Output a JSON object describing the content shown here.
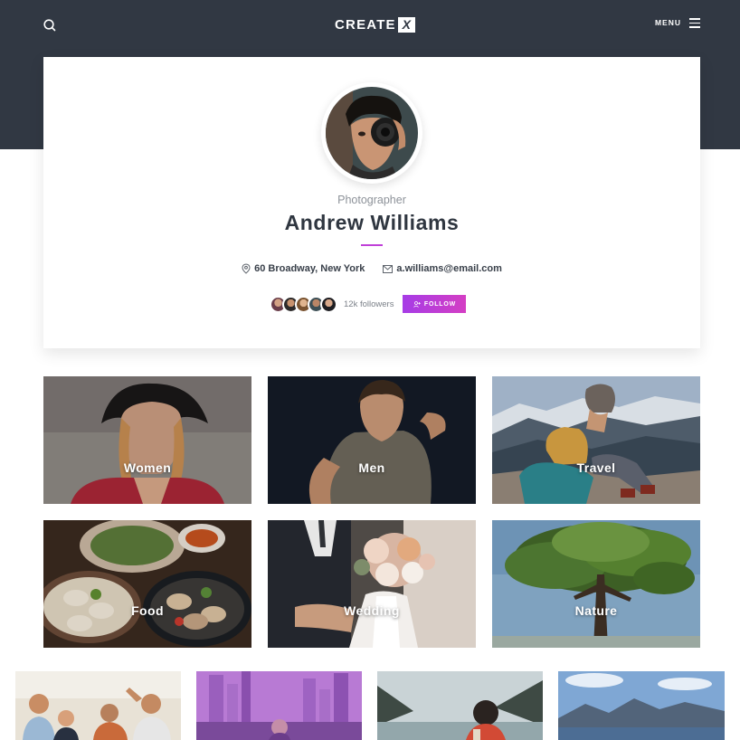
{
  "header": {
    "brand": "CREATE",
    "brand_badge": "X",
    "menu_label": "MENU",
    "icons": {
      "search": "search-icon",
      "menu": "hamburger-icon"
    },
    "background": "#313843"
  },
  "profile": {
    "role": "Photographer",
    "name": "Andrew Williams",
    "location": "60 Broadway, New York",
    "email": "a.williams@email.com",
    "followers": "12k followers",
    "follow_label": "FOLLOW",
    "accent": "#c040d8",
    "icons": {
      "location": "map-pin-icon",
      "email": "envelope-icon",
      "follow": "add-user-icon"
    }
  },
  "categories": [
    {
      "label": "Women"
    },
    {
      "label": "Men"
    },
    {
      "label": "Travel"
    },
    {
      "label": "Food"
    },
    {
      "label": "Wedding"
    },
    {
      "label": "Nature"
    }
  ]
}
